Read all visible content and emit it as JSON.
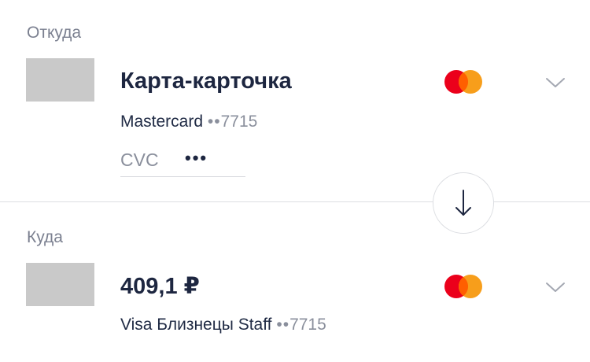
{
  "from": {
    "section_label": "Откуда",
    "card_name": "Карта-карточка",
    "card_type": "Mastercard",
    "mask_dots": "••",
    "last4": "7715",
    "payment_logo": "mastercard-logo",
    "cvc": {
      "label": "CVC",
      "value": "•••"
    },
    "expand_icon": "chevron-down-icon"
  },
  "swap": {
    "icon": "arrow-down-icon"
  },
  "to": {
    "section_label": "Куда",
    "amount": "409,1 ₽",
    "card_name": "Visa Близнецы Staff",
    "mask_dots": "••",
    "last4": "7715",
    "payment_logo": "mastercard-logo",
    "expand_icon": "chevron-down-icon"
  },
  "colors": {
    "mastercard_red": "#eb001b",
    "mastercard_orange": "#f79e1b",
    "mastercard_overlap": "#ff5f00",
    "text_primary": "#1d2640",
    "text_secondary": "#7b8090",
    "thumb_placeholder": "#c9c9c9"
  }
}
